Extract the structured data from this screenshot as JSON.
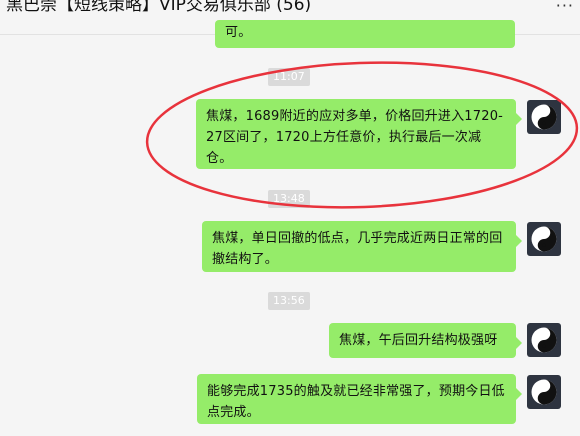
{
  "window": {
    "title": "黑巴崇【短线策略】VIP交易俱乐部 (56)",
    "more_glyph": "···"
  },
  "messages": [
    {
      "type": "text",
      "text": "可。"
    },
    {
      "type": "time",
      "text": "11:07"
    },
    {
      "type": "text",
      "text": "焦煤，1689附近的应对多单，价格回升进入1720-27区间了，1720上方任意价，执行最后一次减仓。"
    },
    {
      "type": "time",
      "text": "13:48"
    },
    {
      "type": "text",
      "text": "焦煤，单日回撤的低点，几乎完成近两日正常的回撤结构了。"
    },
    {
      "type": "time",
      "text": "13:56"
    },
    {
      "type": "text",
      "text": "焦煤，午后回升结构极强呀"
    },
    {
      "type": "text",
      "text": "能够完成1735的触及就已经非常强了，预期今日低点完成。"
    }
  ],
  "colors": {
    "bubble": "#95ec69",
    "background": "#f5f5f5",
    "annotation": "#e8333c",
    "avatar": "#2e3440"
  },
  "icons": {
    "avatar": "yin-yang-icon",
    "menu": "more-icon"
  }
}
